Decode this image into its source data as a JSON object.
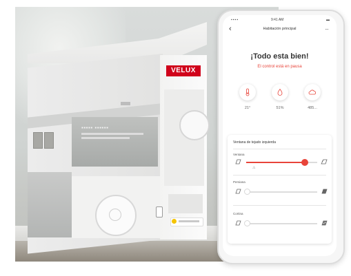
{
  "product_box": {
    "brand_badge": "VELUX",
    "brand_color": "#d0021b"
  },
  "phone": {
    "statusbar": {
      "time": "9:41 AM"
    },
    "nav": {
      "back_icon": "chevron-left-icon",
      "title": "Habitación principal",
      "more_icon": "more-horizontal-icon"
    },
    "headline": "¡Todo esta bien!",
    "subhead": "El control está en pausa",
    "accent_color": "#e8443a",
    "sensors": [
      {
        "icon": "thermometer-icon",
        "value": "21°"
      },
      {
        "icon": "humidity-drop-icon",
        "value": "51%"
      },
      {
        "icon": "co2-cloud-icon",
        "value": "485..."
      }
    ],
    "card": {
      "title": "Ventana de tejado izquierda",
      "rows": [
        {
          "label": "Ventana",
          "level": 0.82,
          "active": true
        },
        {
          "label": "Persiana",
          "level": 0.0,
          "active": false
        },
        {
          "label": "Cortina",
          "level": 0.0,
          "active": false
        }
      ]
    }
  }
}
